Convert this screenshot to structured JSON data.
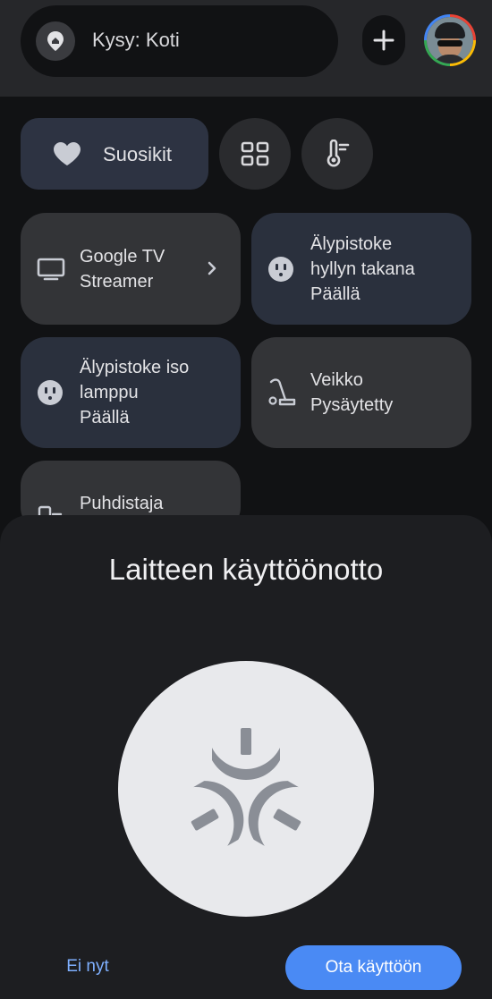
{
  "topbar": {
    "search_label": "Kysy: Koti",
    "add_icon": "plus-icon",
    "avatar_icon": "profile-avatar"
  },
  "chips": {
    "favorites_label": "Suosikit",
    "favorites_icon": "heart-icon",
    "grid_icon": "grid-icon",
    "climate_icon": "thermometer-icon"
  },
  "tiles": [
    {
      "label": "Google TV\nStreamer",
      "icon": "tv-icon",
      "has_chevron": true,
      "style": "dark"
    },
    {
      "label": "Älypistoke\nhyllyn takana\nPäällä",
      "icon": "outlet-icon",
      "style": "blue"
    },
    {
      "label": "Älypistoke iso\nlamppu\nPäällä",
      "icon": "outlet-icon",
      "style": "blue"
    },
    {
      "label": "Veikko\nPysäytetty",
      "icon": "vacuum-icon",
      "style": "dark"
    },
    {
      "label": "Puhdistaja",
      "icon": "purifier-icon",
      "style": "dark"
    }
  ],
  "sheet": {
    "title": "Laitteen käyttöönotto",
    "icon": "matter-icon",
    "secondary_button": "Ei nyt",
    "primary_button": "Ota käyttöön"
  },
  "colors": {
    "background": "#111214",
    "topbar": "#26272a",
    "tile_dark": "#333437",
    "tile_active": "#2a303d",
    "accent": "#4a8af4",
    "link": "#7fb0ff"
  }
}
